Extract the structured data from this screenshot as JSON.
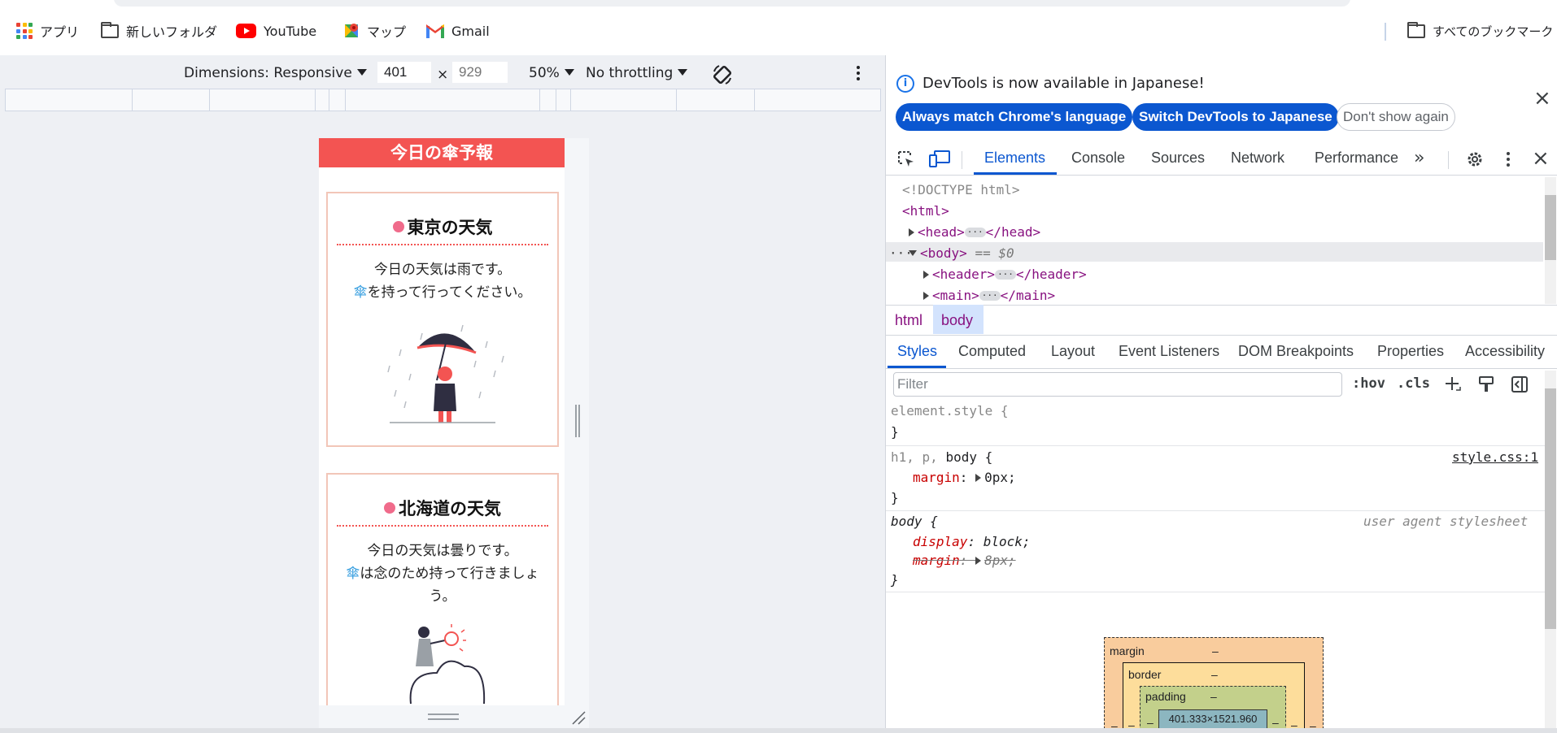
{
  "bookmarks": {
    "apps": "アプリ",
    "folder1": "新しいフォルダ",
    "youtube": "YouTube",
    "maps": "マップ",
    "gmail": "Gmail",
    "all_bookmarks": "すべてのブックマーク"
  },
  "device_toolbar": {
    "dimensions": "Dimensions: Responsive",
    "width": "401",
    "times": "×",
    "height_placeholder": "929",
    "zoom": "50%",
    "throttling": "No throttling"
  },
  "page": {
    "header_title": "今日の傘予報",
    "cards": [
      {
        "title": "東京の天気",
        "line1": "今日の天気は雨です。",
        "umbrella": "傘",
        "line2": "を持って行ってください。"
      },
      {
        "title": "北海道の天気",
        "line1": "今日の天気は曇りです。",
        "umbrella": "傘",
        "line2": "は念のため持って行きましょう。"
      }
    ]
  },
  "devtools": {
    "info_message": "DevTools is now available in Japanese!",
    "btn_match": "Always match Chrome's language",
    "btn_switch": "Switch DevTools to Japanese",
    "btn_dont_show": "Don't show again",
    "tabs": [
      "Elements",
      "Console",
      "Sources",
      "Network",
      "Performance"
    ],
    "dom": {
      "doctype": "<!DOCTYPE html>",
      "html_open": "<html>",
      "head": "<head>",
      "head_close": "</head>",
      "body": "<body>",
      "body_eq": "== $0",
      "header": "<header>",
      "header_close": "</header>",
      "main": "<main>",
      "main_close": "</main>",
      "ellipsis": "···"
    },
    "breadcrumbs": [
      "html",
      "body"
    ],
    "subtabs": [
      "Styles",
      "Computed",
      "Layout",
      "Event Listeners",
      "DOM Breakpoints",
      "Properties",
      "Accessibility"
    ],
    "filter_placeholder": "Filter",
    "hov": ":hov",
    "cls": ".cls",
    "styles": {
      "element_style": "element.style {",
      "close_brace": "}",
      "rule1_selector_muted": "h1, p, ",
      "rule1_selector": "body {",
      "rule1_source": "style.css:1",
      "rule1_prop": "margin",
      "rule1_val": "0px;",
      "rule2_selector": "body {",
      "rule2_source": "user agent stylesheet",
      "rule2_prop1": "display",
      "rule2_val1": "block;",
      "rule2_prop2": "margin",
      "rule2_val2": "8px;"
    },
    "box_model": {
      "margin": "margin",
      "border": "border",
      "padding": "padding",
      "dash": "–",
      "content": "401.333×1521.960"
    }
  }
}
